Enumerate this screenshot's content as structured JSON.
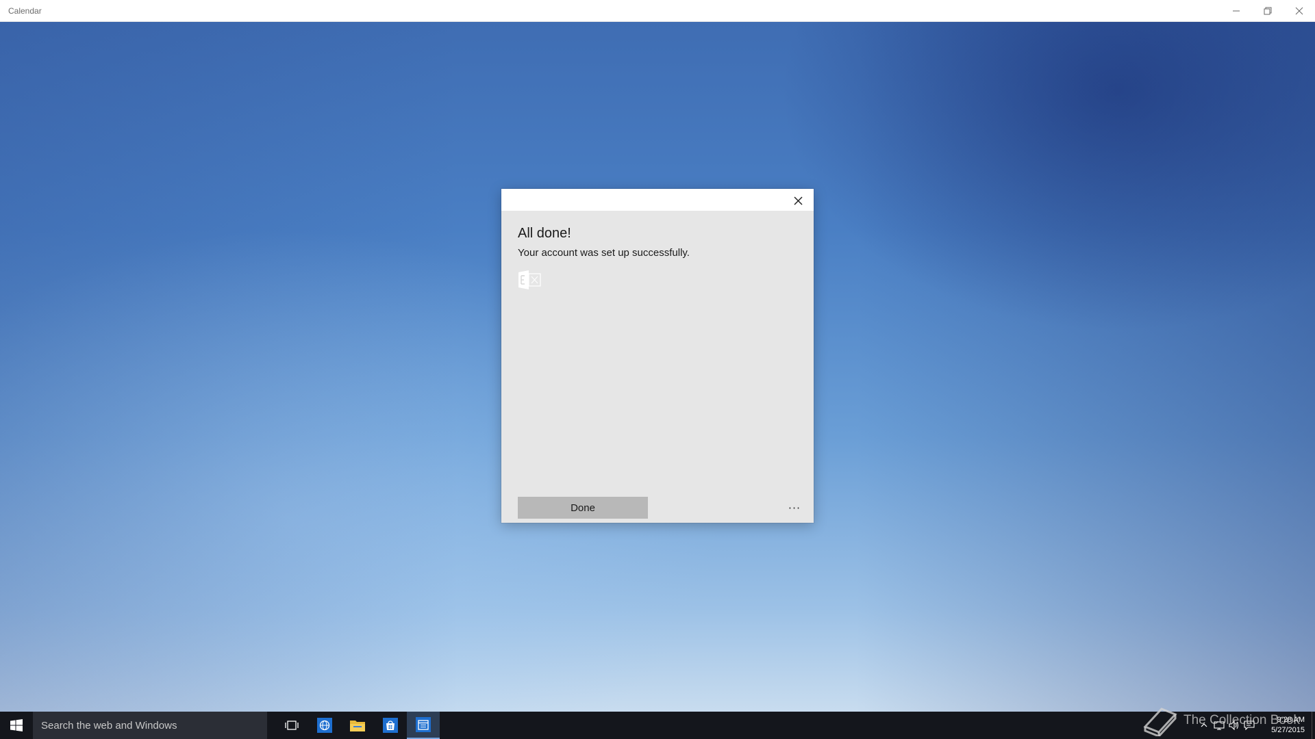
{
  "window": {
    "title": "Calendar",
    "controls": {
      "minimize_icon": "minimize-icon",
      "restore_icon": "restore-icon",
      "close_icon": "close-icon"
    }
  },
  "dialog": {
    "title": "All done!",
    "message": "Your account was set up successfully.",
    "logo_icon": "exchange-logo-icon",
    "done_label": "Done",
    "more_label": "···",
    "close_icon": "close-icon"
  },
  "taskbar": {
    "search_placeholder": "Search the web and Windows",
    "pinned": [
      {
        "name": "task-view",
        "icon": "task-view-icon"
      },
      {
        "name": "edge",
        "icon": "browser-icon"
      },
      {
        "name": "file-explorer",
        "icon": "folder-icon"
      },
      {
        "name": "store",
        "icon": "store-icon"
      },
      {
        "name": "calendar",
        "icon": "calendar-icon",
        "active": true
      }
    ],
    "clock": {
      "time": "9:28 AM",
      "date": "5/27/2015"
    }
  },
  "watermark": {
    "text": "The Collection Book"
  },
  "colors": {
    "taskbar": "#14161c",
    "dialog_bg": "#e6e6e6",
    "done_button": "#b8b8b8",
    "accent": "#78a6e0"
  }
}
